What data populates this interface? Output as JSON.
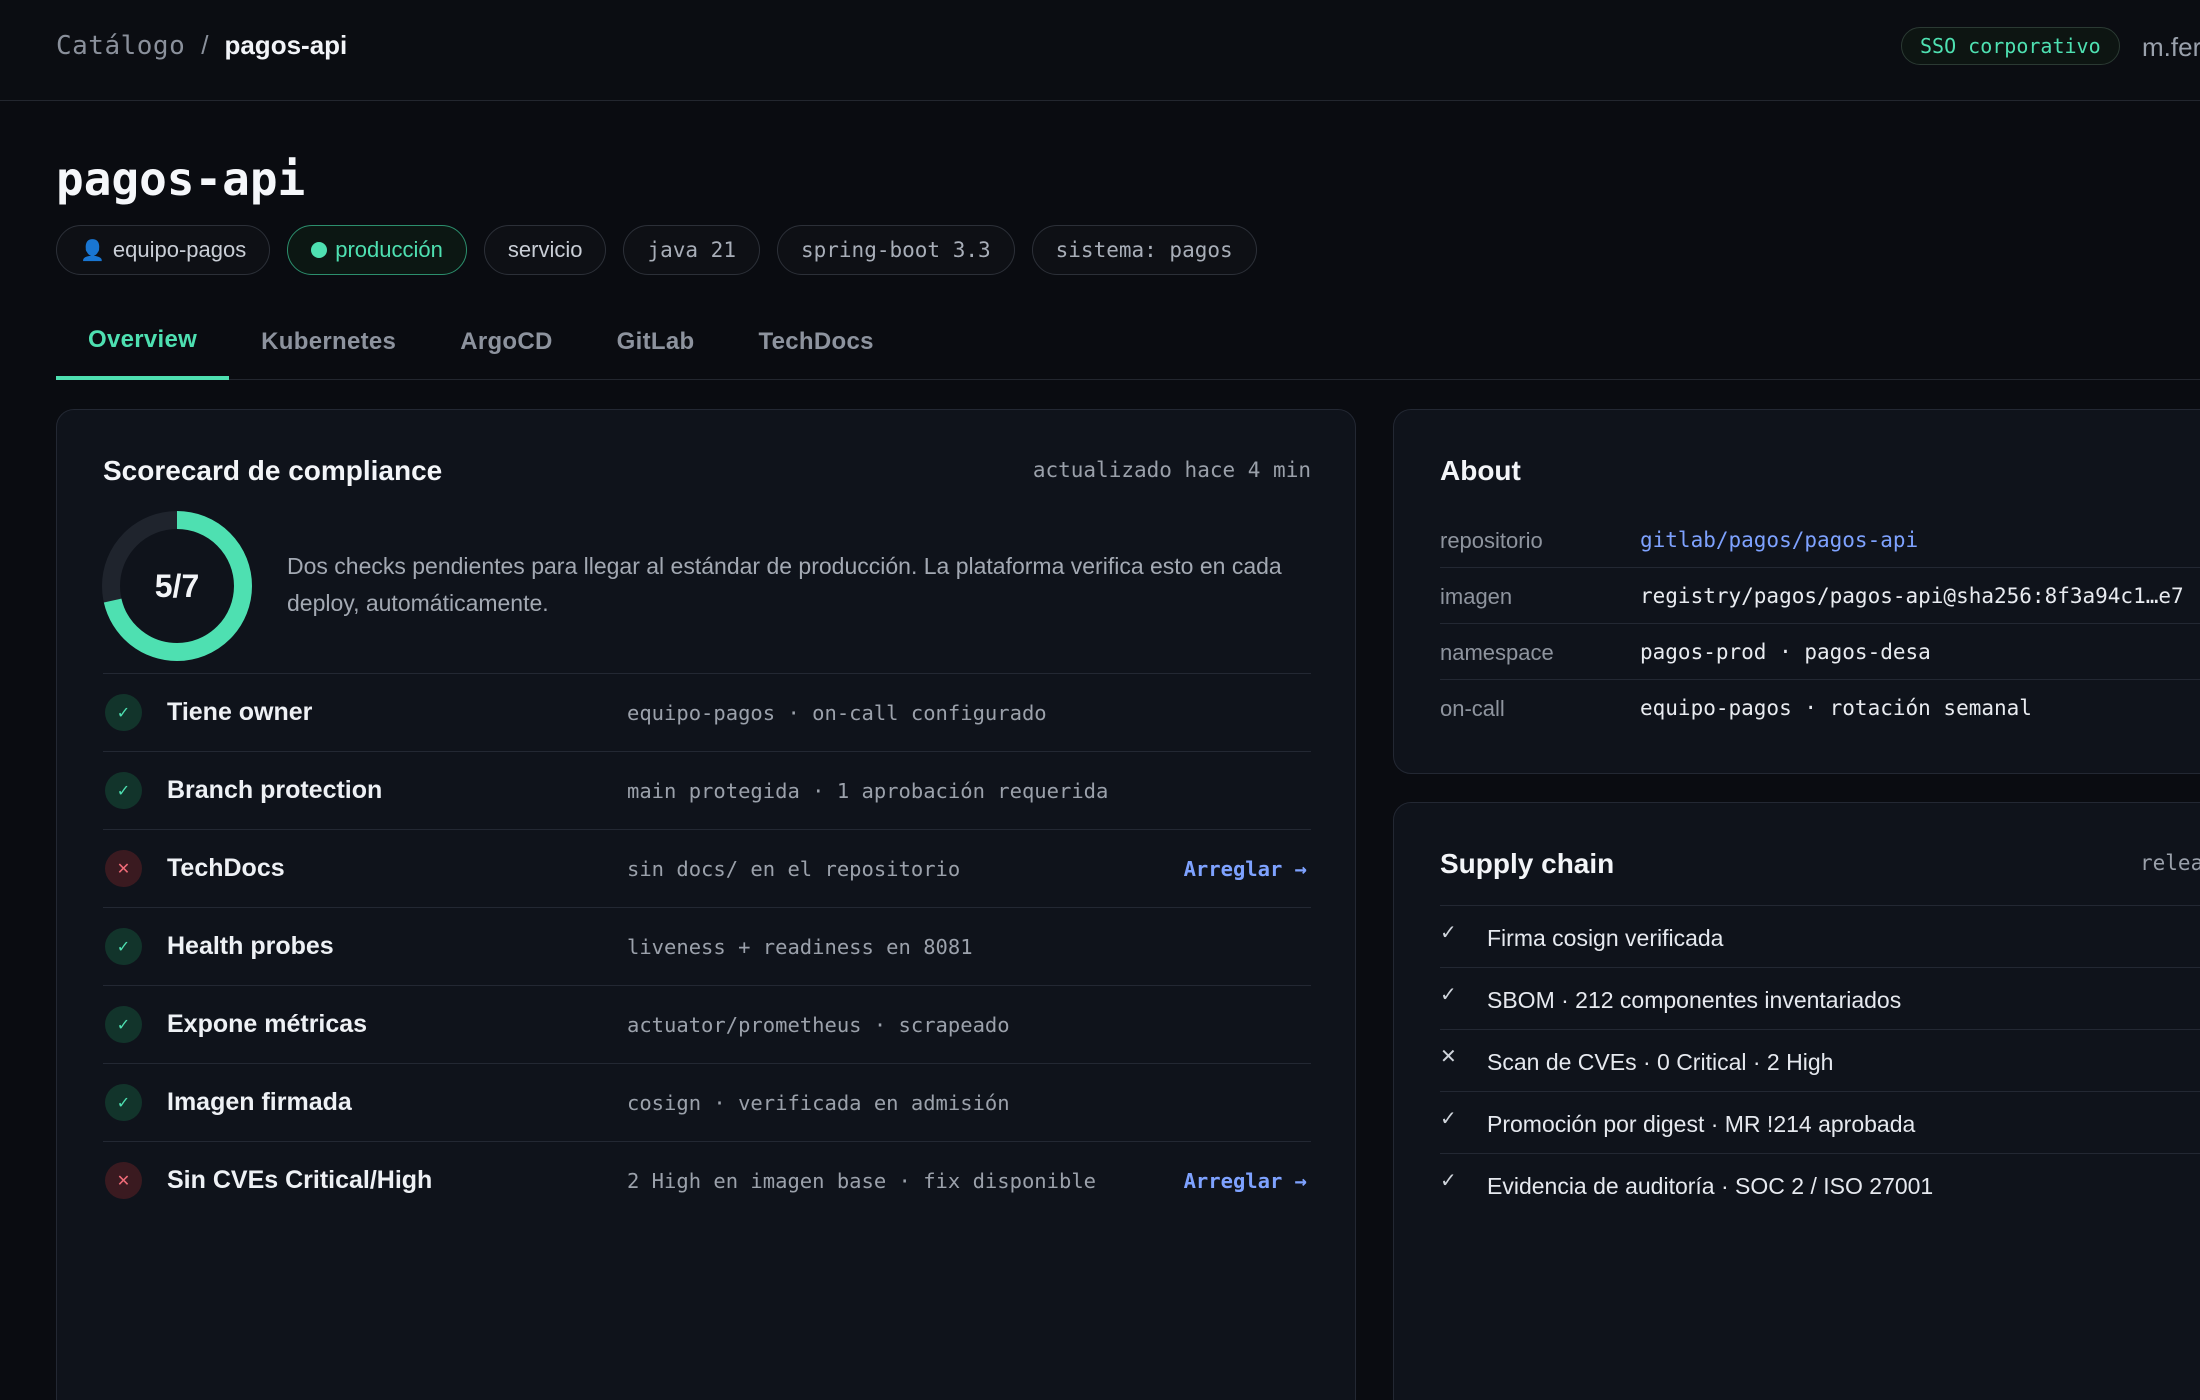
{
  "breadcrumb": {
    "parent": "Catálogo",
    "separator": "/",
    "current": "pagos-api"
  },
  "header": {
    "sso_badge": "SSO corporativo",
    "user": "m.fer"
  },
  "service": {
    "title": "pagos-api",
    "chips": {
      "owner": "equipo-pagos",
      "environment": "producción",
      "kind": "servicio",
      "runtime": "java 21",
      "framework": "spring-boot 3.3",
      "system": "sistema: pagos"
    }
  },
  "tabs": [
    {
      "label": "Overview",
      "active": true
    },
    {
      "label": "Kubernetes",
      "active": false
    },
    {
      "label": "ArgoCD",
      "active": false
    },
    {
      "label": "GitLab",
      "active": false
    },
    {
      "label": "TechDocs",
      "active": false
    }
  ],
  "scorecard": {
    "title": "Scorecard de compliance",
    "updated": "actualizado hace 4 min",
    "score_label": "5/7",
    "passed": 5,
    "total": 7,
    "summary": "Dos checks pendientes para llegar al estándar de producción. La plataforma verifica esto en cada deploy, automáticamente.",
    "checks": [
      {
        "status": "ok",
        "icon": "✓",
        "name": "Tiene owner",
        "detail": "equipo-pagos · on-call configurado",
        "action": ""
      },
      {
        "status": "ok",
        "icon": "✓",
        "name": "Branch protection",
        "detail": "main protegida · 1 aprobación requerida",
        "action": ""
      },
      {
        "status": "bad",
        "icon": "✕",
        "name": "TechDocs",
        "detail": "sin docs/ en el repositorio",
        "action": "Arreglar →"
      },
      {
        "status": "ok",
        "icon": "✓",
        "name": "Health probes",
        "detail": "liveness + readiness en 8081",
        "action": ""
      },
      {
        "status": "ok",
        "icon": "✓",
        "name": "Expone métricas",
        "detail": "actuator/prometheus · scrapeado",
        "action": ""
      },
      {
        "status": "ok",
        "icon": "✓",
        "name": "Imagen firmada",
        "detail": "cosign · verificada en admisión",
        "action": ""
      },
      {
        "status": "bad",
        "icon": "✕",
        "name": "Sin CVEs Critical/High",
        "detail": "2 High en imagen base · fix disponible",
        "action": "Arreglar →"
      }
    ]
  },
  "about": {
    "title": "About",
    "rows": [
      {
        "key": "repositorio",
        "value": "gitlab/pagos/pagos-api",
        "link": true
      },
      {
        "key": "imagen",
        "value": "registry/pagos/pagos-api@sha256:8f3a94c1…e7",
        "link": false
      },
      {
        "key": "namespace",
        "value": "pagos-prod · pagos-desa",
        "link": false
      },
      {
        "key": "on-call",
        "value": "equipo-pagos · rotación semanal",
        "link": false
      }
    ]
  },
  "supply_chain": {
    "title": "Supply chain",
    "release": "relea",
    "items": [
      {
        "mark": "✓",
        "text": "Firma cosign verificada"
      },
      {
        "mark": "✓",
        "text": "SBOM · 212 componentes inventariados"
      },
      {
        "mark": "✕",
        "text": "Scan de CVEs · 0 Critical · 2 High"
      },
      {
        "mark": "✓",
        "text": "Promoción por digest · MR !214 aprobada"
      },
      {
        "mark": "✓",
        "text": "Evidencia de auditoría · SOC 2 / ISO 27001"
      }
    ]
  },
  "colors": {
    "accent": "#4ee0b1",
    "danger": "#ef6b78",
    "link": "#7ea2ff",
    "background": "#0a0c11",
    "card": "#0f131b"
  }
}
